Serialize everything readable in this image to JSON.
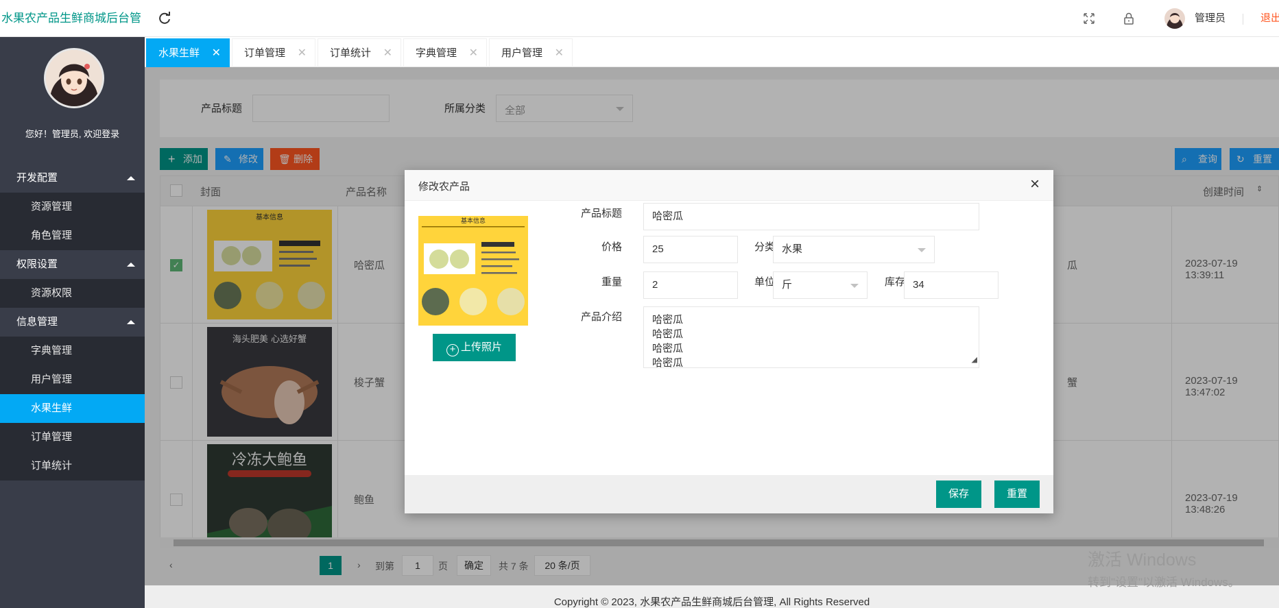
{
  "app": {
    "title": "水果农产品生鲜商城后台管"
  },
  "header": {
    "user_name": "管理员",
    "exit_label": "退出"
  },
  "sidebar": {
    "welcome": "您好！管理员, 欢迎登录",
    "groups": [
      {
        "label": "开发配置",
        "items": [
          "资源管理",
          "角色管理"
        ]
      },
      {
        "label": "权限设置",
        "items": [
          "资源权限"
        ]
      },
      {
        "label": "信息管理",
        "items": [
          "字典管理",
          "用户管理",
          "水果生鲜",
          "订单管理",
          "订单统计"
        ]
      }
    ],
    "active_item": "水果生鲜"
  },
  "tabs": [
    {
      "label": "水果生鲜",
      "active": true
    },
    {
      "label": "订单管理",
      "active": false
    },
    {
      "label": "订单统计",
      "active": false
    },
    {
      "label": "字典管理",
      "active": false
    },
    {
      "label": "用户管理",
      "active": false
    }
  ],
  "search": {
    "title_label": "产品标题",
    "category_label": "所属分类",
    "category_value": "全部"
  },
  "toolbar": {
    "add": "添加",
    "edit": "修改",
    "delete": "删除",
    "query": "查询",
    "reset": "重置"
  },
  "table": {
    "headers": {
      "cover": "封面",
      "name": "产品名称",
      "created": "创建时间"
    },
    "rows": [
      {
        "name": "哈密瓜",
        "extra": "瓜",
        "created": "2023-07-19 13:39:11",
        "checked": true
      },
      {
        "name": "梭子蟹",
        "extra": "蟹",
        "created": "2023-07-19 13:47:02",
        "checked": false
      },
      {
        "name": "鲍鱼",
        "extra": "",
        "created": "2023-07-19 13:48:26",
        "checked": false
      }
    ]
  },
  "pager": {
    "current": "1",
    "goto_label": "到第",
    "page_input": "1",
    "page_unit": "页",
    "confirm": "确定",
    "total": "共 7 条",
    "page_size": "20 条/页"
  },
  "footer": {
    "copyright": "Copyright © 2023, 水果农产品生鲜商城后台管理, All Rights Reserved"
  },
  "modal": {
    "title": "修改农产品",
    "upload_label": "上传照片",
    "fields": {
      "title_label": "产品标题",
      "title_value": "哈密瓜",
      "price_label": "价格",
      "price_value": "25",
      "category_label": "分类",
      "category_value": "水果",
      "weight_label": "重量",
      "weight_value": "2",
      "unit_label": "单位",
      "unit_value": "斤",
      "stock_label": "库存",
      "stock_value": "34",
      "intro_label": "产品介绍",
      "intro_lines": [
        "哈密瓜",
        "哈密瓜",
        "哈密瓜",
        "哈密瓜"
      ]
    },
    "save": "保存",
    "reset": "重置"
  },
  "preview_image": {
    "heading": "基本信息"
  },
  "cover_texts": {
    "crab": "海头肥美 心选好蟹",
    "abalone": "冷冻大鲍鱼"
  },
  "watermark": {
    "line1": "激活 Windows",
    "line2": "转到\"设置\"以激活 Windows。"
  },
  "colors": {
    "primary": "#009688",
    "accent": "#03a9f4",
    "sidebar": "#393d49",
    "danger": "#ff5722"
  }
}
